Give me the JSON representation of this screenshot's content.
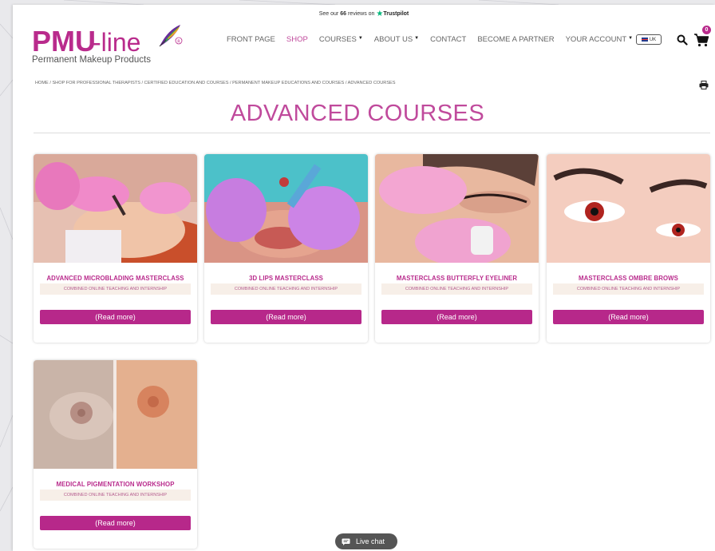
{
  "topbar": {
    "pre": "See our",
    "count": "66",
    "post": "reviews on",
    "brand": "Trustpilot"
  },
  "logo": {
    "main": "PMU",
    "line": "-line",
    "sub": "Permanent Makeup Products"
  },
  "nav": {
    "items": [
      {
        "label": "FRONT PAGE",
        "active": false,
        "dropdown": false
      },
      {
        "label": "SHOP",
        "active": true,
        "dropdown": false
      },
      {
        "label": "COURSES",
        "active": false,
        "dropdown": true
      },
      {
        "label": "ABOUT US",
        "active": false,
        "dropdown": true
      },
      {
        "label": "CONTACT",
        "active": false,
        "dropdown": false
      },
      {
        "label": "BECOME A PARTNER",
        "active": false,
        "dropdown": false
      },
      {
        "label": "YOUR ACCOUNT",
        "active": false,
        "dropdown": true
      }
    ],
    "caret": "▼"
  },
  "header_tools": {
    "lang": "UK",
    "cart_count": "0"
  },
  "breadcrumb": "HOME / SHOP FOR PROFESSIONAL THERAPISTS / CERTIFIED EDUCATION AND COURSES / PERMANENT MAKEUP EDUCATIONS AND COURSES / ADVANCED COURSES",
  "page_title": "ADVANCED COURSES",
  "products": [
    {
      "title": "ADVANCED MICROBLADING MASTERCLASS",
      "subtitle": "COMBINED ONLINE TEACHING AND INTERNSHIP",
      "button": "(Read more)"
    },
    {
      "title": "3D LIPS MASTERCLASS",
      "subtitle": "COMBINED ONLINE TEACHING AND INTERNSHIP",
      "button": "(Read more)"
    },
    {
      "title": "MASTERCLASS BUTTERFLY EYELINER",
      "subtitle": "COMBINED ONLINE TEACHING AND INTERNSHIP",
      "button": "(Read more)"
    },
    {
      "title": "MASTERCLASS OMBRE BROWS",
      "subtitle": "COMBINED ONLINE TEACHING AND INTERNSHIP",
      "button": "(Read more)"
    },
    {
      "title": "MEDICAL PIGMENTATION WORKSHOP",
      "subtitle": "COMBINED ONLINE TEACHING AND INTERNSHIP",
      "button": "(Read more)"
    }
  ],
  "live_chat": "Live chat",
  "colors": {
    "brand": "#b92b8c",
    "title": "#c04a9c",
    "button": "#b7288a",
    "subtitle_bg": "#f7efe8"
  }
}
